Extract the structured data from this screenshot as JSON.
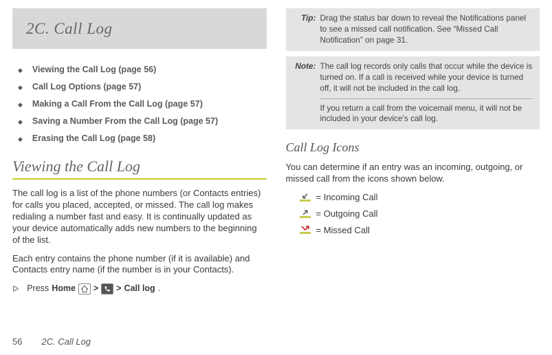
{
  "chapter": {
    "title": "2C. Call Log"
  },
  "toc": [
    {
      "text": "Viewing the Call Log (page 56)"
    },
    {
      "text": "Call Log Options (page 57)"
    },
    {
      "text": "Making a Call From the Call Log  (page 57)"
    },
    {
      "text": "Saving a Number From the Call Log (page 57)"
    },
    {
      "text": "Erasing the Call Log (page 58)"
    }
  ],
  "section1": {
    "heading": "Viewing the Call Log",
    "p1": "The call log is a list of the phone numbers (or Contacts entries) for calls you placed, accepted, or missed. The call log makes redialing a number fast and easy. It is continually updated as your device automatically adds new numbers to the beginning of the list.",
    "p2": "Each entry contains the phone number (if it is available) and Contacts entry name (if the number is in your Contacts).",
    "step": {
      "press": "Press",
      "home": "Home",
      "gt1": ">",
      "gt2": ">",
      "calllog": "Call log",
      "dot": "."
    }
  },
  "tip": {
    "label": "Tip:",
    "body": "Drag the status bar down to reveal the Notifications panel to see a missed call notification. See “Missed Call Notification” on page 31."
  },
  "note": {
    "label": "Note:",
    "body1": "The call log records only calls that occur while the device is turned on. If a call is received while your device is turned off, it will not be included in the call log.",
    "body2": "If you return a call from the voicemail menu, it will not be included in your device’s call log."
  },
  "section2": {
    "heading": "Call Log Icons",
    "p": "You can determine if an entry was an incoming, outgoing, or missed call from the icons shown below.",
    "icons": {
      "incoming": "= Incoming Call",
      "outgoing": "= Outgoing Call",
      "missed": "= Missed Call"
    }
  },
  "footer": {
    "pagenum": "56",
    "chapter": "2C. Call Log"
  }
}
